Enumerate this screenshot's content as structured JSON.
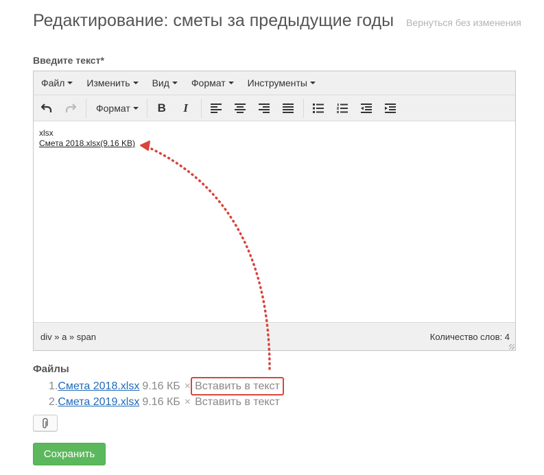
{
  "header": {
    "title": "Редактирование: сметы за предыдущие годы",
    "back_link": "Вернуться без изменения"
  },
  "form": {
    "text_label": "Введите текст*"
  },
  "editor": {
    "menus": [
      "Файл",
      "Изменить",
      "Вид",
      "Формат",
      "Инструменты"
    ],
    "toolbar": {
      "format_label": "Формат",
      "bold": "B",
      "italic": "I",
      "icons": [
        "undo-icon",
        "redo-icon",
        "align-left-icon",
        "align-center-icon",
        "align-right-icon",
        "align-justify-icon",
        "bullet-list-icon",
        "numbered-list-icon",
        "outdent-icon",
        "indent-icon"
      ]
    },
    "content": {
      "line1": "xlsx",
      "link_name": "Смета 2018.xlsx",
      "link_size": "(9.16 KB)"
    },
    "statusbar": {
      "path": "div » a » span",
      "word_count": "Количество слов: 4"
    }
  },
  "files": {
    "title": "Файлы",
    "items": [
      {
        "index": "1.",
        "name": "Смета 2018.xlsx",
        "size": "9.16 КБ",
        "remove": "×",
        "insert": "Вставить в текст"
      },
      {
        "index": "2.",
        "name": "Смета 2019.xlsx",
        "size": "9.16 КБ",
        "remove": "×",
        "insert": "Вставить в текст"
      }
    ]
  },
  "attach_icon": "paperclip-icon",
  "save_button": "Сохранить",
  "colors": {
    "accent_green": "#5cb85c",
    "link_blue": "#1f6ab8",
    "annotation_red": "#d9443c"
  }
}
